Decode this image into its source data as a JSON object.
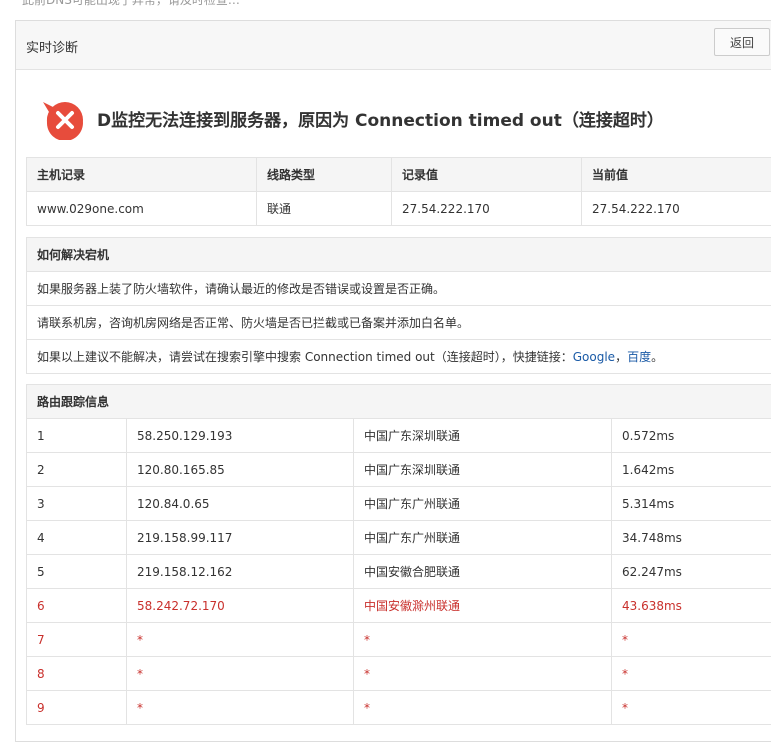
{
  "top_strip_text": "此前DNS可能出现了异常，请及时检查…",
  "panel": {
    "title": "实时诊断",
    "back_label": "返回"
  },
  "alert": {
    "message": "D监控无法连接到服务器，原因为 Connection timed out（连接超时）",
    "icon": "error-x-icon",
    "color": "#e74c3c"
  },
  "record_table": {
    "headers": [
      "主机记录",
      "线路类型",
      "记录值",
      "当前值"
    ],
    "row": [
      "www.029one.com",
      "联通",
      "27.54.222.170",
      "27.54.222.170"
    ]
  },
  "solve": {
    "title": "如何解决宕机",
    "items": [
      "如果服务器上装了防火墙软件，请确认最近的修改是否错误或设置是否正确。",
      "请联系机房，咨询机房网络是否正常、防火墙是否已拦截或已备案并添加白名单。"
    ],
    "last_prefix": "如果以上建议不能解决，请尝试在搜索引擎中搜索 Connection timed out（连接超时），快捷链接：",
    "link_google": "Google",
    "separator": "，",
    "link_baidu": "百度",
    "suffix": "。"
  },
  "trace": {
    "title": "路由跟踪信息",
    "rows": [
      {
        "hop": "1",
        "ip": "58.250.129.193",
        "location": "中国广东深圳联通",
        "time": "0.572ms",
        "highlight": false
      },
      {
        "hop": "2",
        "ip": "120.80.165.85",
        "location": "中国广东深圳联通",
        "time": "1.642ms",
        "highlight": false
      },
      {
        "hop": "3",
        "ip": "120.84.0.65",
        "location": "中国广东广州联通",
        "time": "5.314ms",
        "highlight": false
      },
      {
        "hop": "4",
        "ip": "219.158.99.117",
        "location": "中国广东广州联通",
        "time": "34.748ms",
        "highlight": false
      },
      {
        "hop": "5",
        "ip": "219.158.12.162",
        "location": "中国安徽合肥联通",
        "time": "62.247ms",
        "highlight": false
      },
      {
        "hop": "6",
        "ip": "58.242.72.170",
        "location": "中国安徽滁州联通",
        "time": "43.638ms",
        "highlight": true
      },
      {
        "hop": "7",
        "ip": "*",
        "location": "*",
        "time": "*",
        "highlight": true
      },
      {
        "hop": "8",
        "ip": "*",
        "location": "*",
        "time": "*",
        "highlight": true
      },
      {
        "hop": "9",
        "ip": "*",
        "location": "*",
        "time": "*",
        "highlight": true
      }
    ]
  }
}
